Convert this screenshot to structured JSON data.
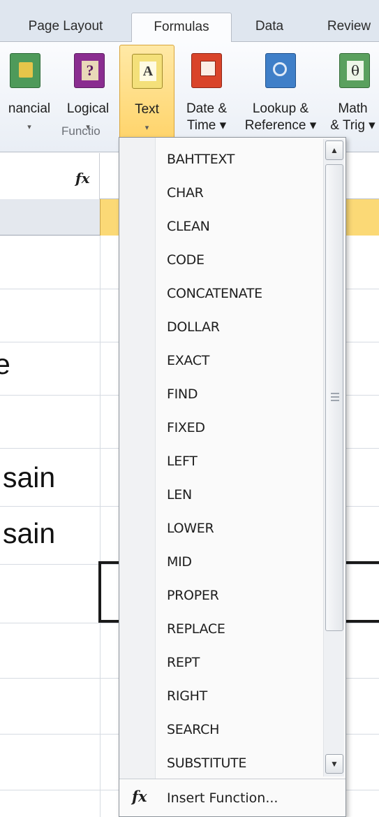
{
  "ribbon_tabs": [
    {
      "label": "Page Layout"
    },
    {
      "label": "Formulas"
    },
    {
      "label": "Data"
    },
    {
      "label": "Review"
    }
  ],
  "function_library": {
    "group_label": "Functio",
    "buttons": [
      {
        "line1": "nancial",
        "line2": "▾",
        "icon": "financial-book-icon",
        "color": "#4e9a5a"
      },
      {
        "line1": "Logical",
        "line2": "▾",
        "icon": "logical-book-icon",
        "color": "#8a2d90"
      },
      {
        "line1": "Text",
        "line2": "▾",
        "icon": "text-book-icon",
        "color": "#e3c338"
      },
      {
        "line1": "Date &",
        "line2": "Time ▾",
        "icon": "date-time-book-icon",
        "color": "#d9442a"
      },
      {
        "line1": "Lookup &",
        "line2": "Reference ▾",
        "icon": "lookup-reference-book-icon",
        "color": "#3f7fc8"
      },
      {
        "line1": "Math",
        "line2": "& Trig ▾",
        "icon": "math-trig-book-icon",
        "color": "#5aa05e"
      }
    ]
  },
  "formula_bar": {
    "fx_label": "fx"
  },
  "grid": {
    "cells": [
      {
        "text": "e"
      },
      {
        "text": "sain"
      },
      {
        "text": "sain"
      }
    ]
  },
  "text_menu": {
    "items": [
      "BAHTTEXT",
      "CHAR",
      "CLEAN",
      "CODE",
      "CONCATENATE",
      "DOLLAR",
      "EXACT",
      "FIND",
      "FIXED",
      "LEFT",
      "LEN",
      "LOWER",
      "MID",
      "PROPER",
      "REPLACE",
      "REPT",
      "RIGHT",
      "SEARCH",
      "SUBSTITUTE"
    ],
    "footer_label": "Insert Function...",
    "footer_icon": "fx"
  },
  "colors": {
    "accent": "#ffd46b",
    "ribbon_bg": "#dfe6ef",
    "active_cell_border": "#1a1a1a"
  }
}
